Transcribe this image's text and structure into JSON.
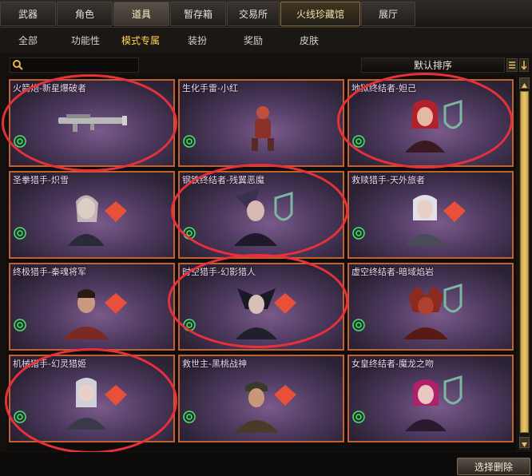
{
  "top_tabs": [
    {
      "label": "武器"
    },
    {
      "label": "角色"
    },
    {
      "label": "道具"
    },
    {
      "label": "暂存箱"
    },
    {
      "label": "交易所"
    },
    {
      "label": "火线珍藏馆"
    },
    {
      "label": "展厅"
    }
  ],
  "active_top_tab": "道具",
  "sub_tabs": [
    {
      "label": "全部"
    },
    {
      "label": "功能性"
    },
    {
      "label": "模式专属"
    },
    {
      "label": "装扮"
    },
    {
      "label": "奖励"
    },
    {
      "label": "皮肤"
    }
  ],
  "active_sub_tab": "模式专属",
  "search": {
    "value": "",
    "placeholder": ""
  },
  "sort": {
    "label": "默认排序"
  },
  "items": [
    {
      "name": "火箭炮-新星爆破者",
      "type": "weapon"
    },
    {
      "name": "生化手雷-小红",
      "type": "grenade"
    },
    {
      "name": "地狱终结者-妲己",
      "type": "character"
    },
    {
      "name": "圣拳猎手-炽雪",
      "type": "character"
    },
    {
      "name": "钢铁终结者-残翼恶魔",
      "type": "character"
    },
    {
      "name": "救赎猎手-天外旅者",
      "type": "character"
    },
    {
      "name": "终极猎手-秦魂将军",
      "type": "character"
    },
    {
      "name": "时空猎手-幻影猎人",
      "type": "character"
    },
    {
      "name": "虚空终结者-暗域焰岩",
      "type": "character"
    },
    {
      "name": "机械猎手-幻灵猎姬",
      "type": "character"
    },
    {
      "name": "救世主-黑桃战神",
      "type": "character"
    },
    {
      "name": "女皇终结者-魔龙之吻",
      "type": "character"
    }
  ],
  "buttons": {
    "delete": "选择删除"
  },
  "colors": {
    "card_border": "#c2602e",
    "annotation_circle": "#e8303a",
    "active_subtab": "#ffd34d"
  }
}
